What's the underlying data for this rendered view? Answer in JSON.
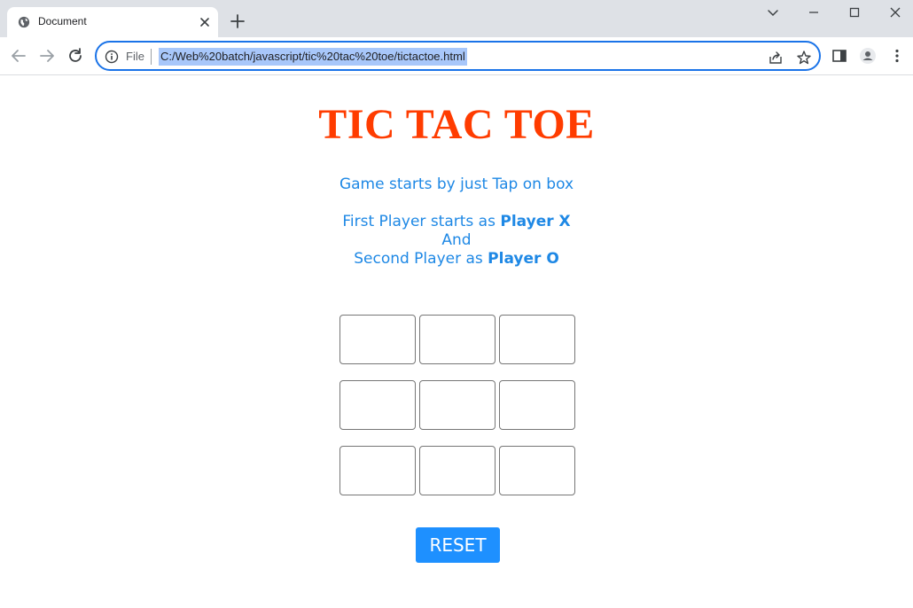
{
  "browser": {
    "tab_title": "Document",
    "scheme_label": "File",
    "url": "C:/Web%20batch/javascript/tic%20tac%20toe/tictactoe.html"
  },
  "page": {
    "title": "TIC TAC TOE",
    "intro": "Game starts by just Tap on box",
    "line1_prefix": "First Player starts as ",
    "line1_player": "Player X",
    "line2": "And",
    "line3_prefix": "Second Player as ",
    "line3_player": "Player O",
    "reset_label": "RESET",
    "board": [
      "",
      "",
      "",
      "",
      "",
      "",
      "",
      "",
      ""
    ]
  },
  "colors": {
    "title": "#ff3c00",
    "instructions": "#1e88e5",
    "reset_button": "#1e90ff",
    "focus_ring": "#1a73e8",
    "url_highlight": "#a8c7fa"
  }
}
